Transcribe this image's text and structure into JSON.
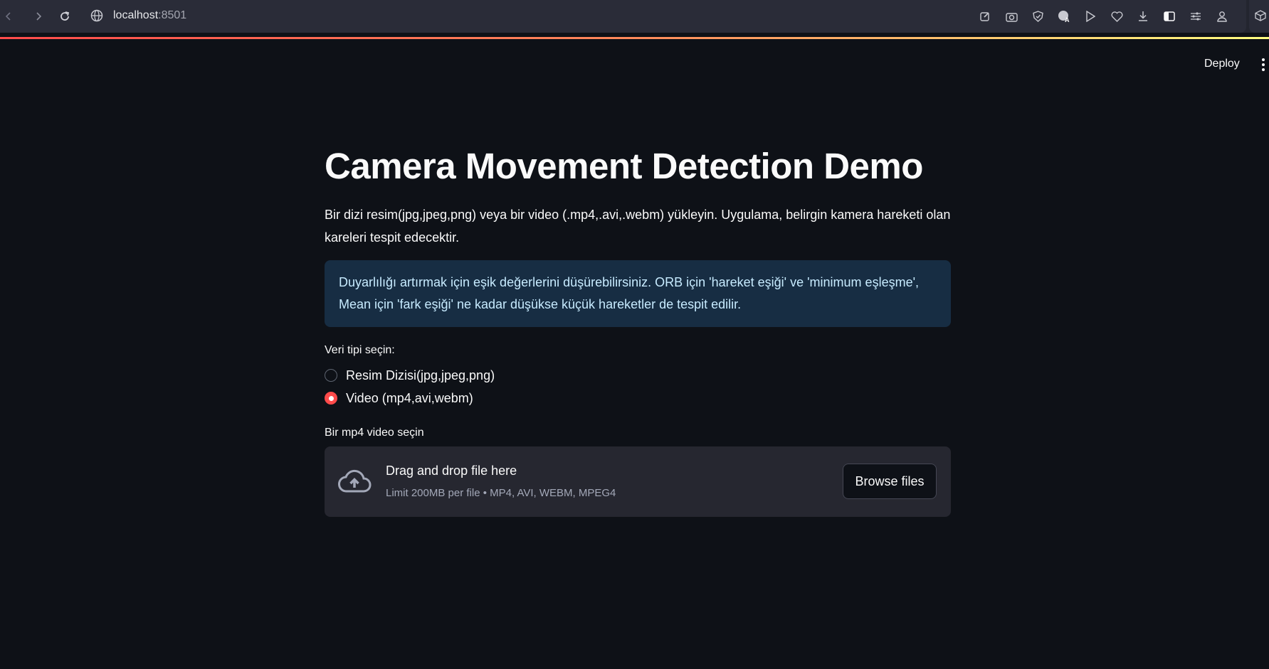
{
  "browser": {
    "url_host": "localhost",
    "url_port": ":8501",
    "toolbar_icons": [
      "edit-icon",
      "camera-icon",
      "shield-icon",
      "translate-icon",
      "play-icon",
      "heart-icon",
      "download-icon",
      "sidebar-icon",
      "sliders-icon",
      "profile-icon"
    ]
  },
  "header": {
    "deploy_label": "Deploy"
  },
  "main": {
    "title": "Camera Movement Detection Demo",
    "description": "Bir dizi resim(jpg,jpeg,png) veya bir video (.mp4,.avi,.webm) yükleyin. Uygulama, belirgin kamera hareketi olan kareleri tespit edecektir.",
    "info": "Duyarlılığı artırmak için eşik değerlerini düşürebilirsiniz. ORB için 'hareket eşiği' ve 'minimum eşleşme', Mean için 'fark eşiği' ne kadar düşükse küçük hareketler de tespit edilir.",
    "radio": {
      "label": "Veri tipi seçin:",
      "options": [
        "Resim Dizisi(jpg,jpeg,png)",
        "Video (mp4,avi,webm)"
      ],
      "selected_index": 1
    },
    "uploader": {
      "label": "Bir mp4 video seçin",
      "title": "Drag and drop file here",
      "subtitle": "Limit 200MB per file • MP4, AVI, WEBM, MPEG4",
      "button": "Browse files"
    }
  },
  "colors": {
    "accent": "#ff4b4b",
    "background": "#0e1117",
    "info_bg": "#172d43",
    "info_text": "#c7ebff"
  }
}
